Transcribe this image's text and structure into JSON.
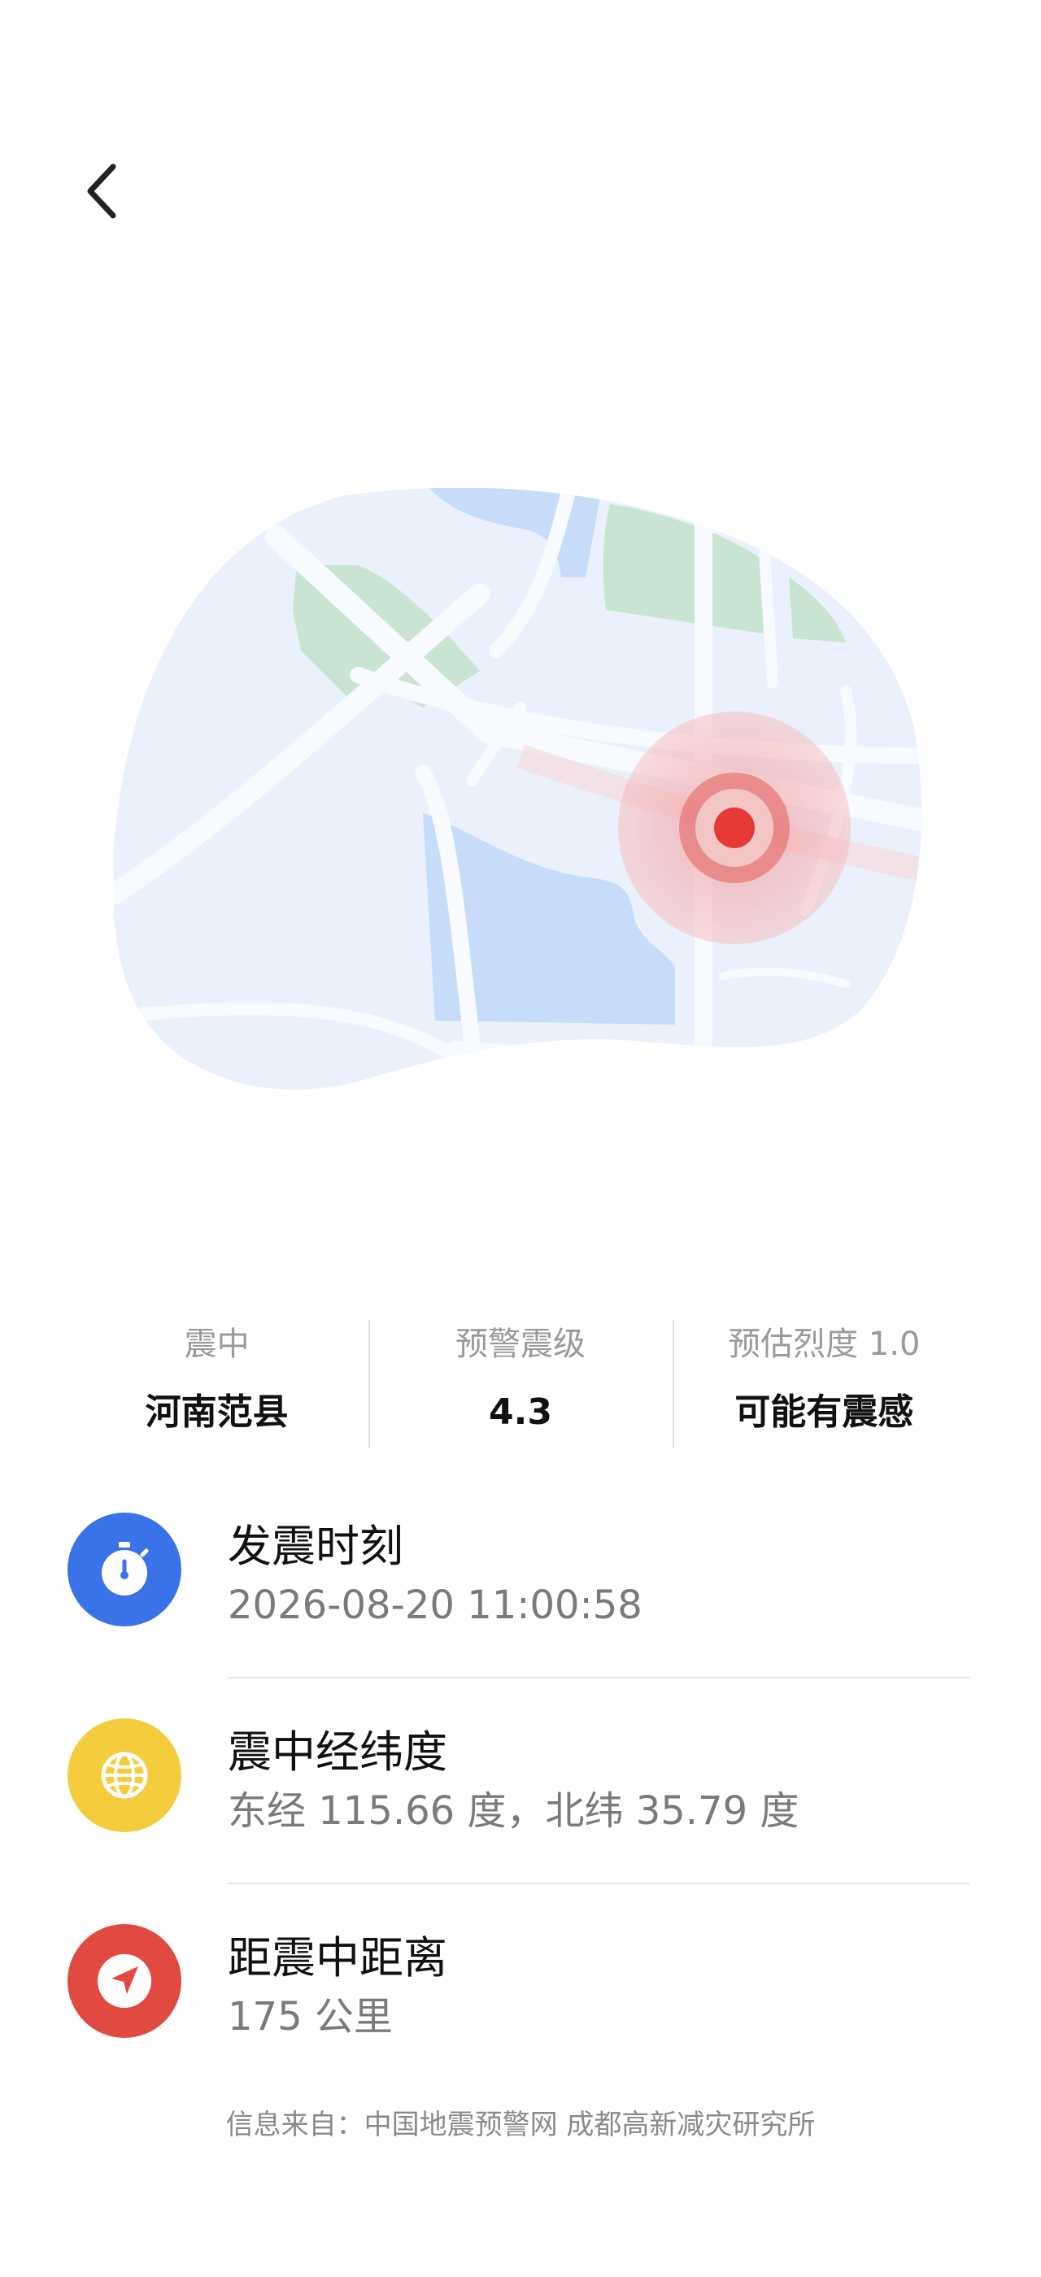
{
  "header": {
    "back_icon": "chevron-left-icon"
  },
  "map": {
    "marker_color": "#e53935"
  },
  "stats": [
    {
      "label": "震中",
      "value": "河南范县"
    },
    {
      "label": "预警震级",
      "value": "4.3"
    },
    {
      "label": "预估烈度 1.0",
      "value": "可能有震感"
    }
  ],
  "details": [
    {
      "icon": "stopwatch-icon",
      "icon_color": "#3a73e8",
      "title": "发震时刻",
      "value": "2026-08-20 11:00:58"
    },
    {
      "icon": "globe-icon",
      "icon_color": "#f5cc3d",
      "title": "震中经纬度",
      "value": "东经 115.66 度，北纬 35.79 度"
    },
    {
      "icon": "navigation-arrow-icon",
      "icon_color": "#e04a41",
      "title": "距震中距离",
      "value": "175 公里"
    }
  ],
  "footer": {
    "source": "信息来自：中国地震预警网 成都高新减灾研究所"
  }
}
